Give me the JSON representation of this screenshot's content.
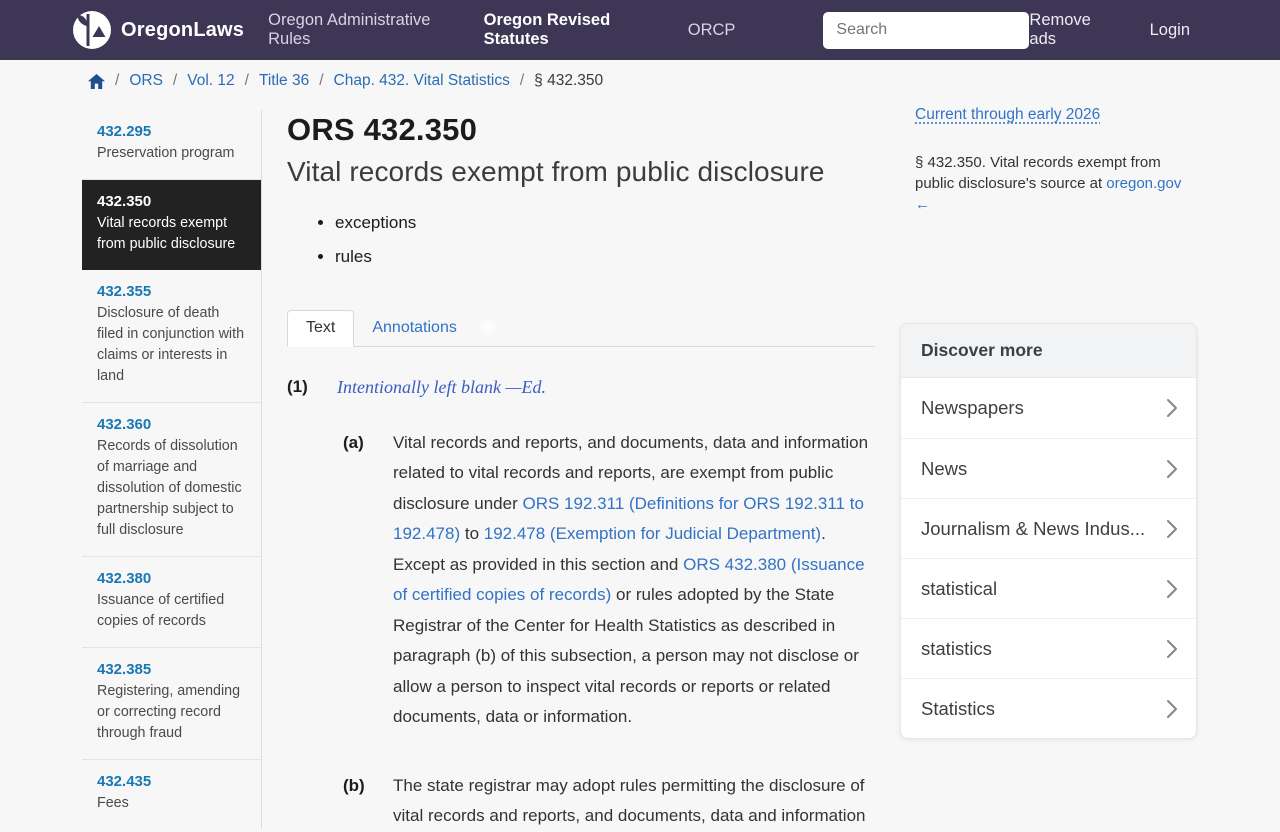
{
  "header": {
    "brand": "OregonLaws",
    "nav": [
      {
        "label": "Oregon Administrative Rules",
        "active": false
      },
      {
        "label": "Oregon Revised Statutes",
        "active": true
      },
      {
        "label": "ORCP",
        "active": false
      }
    ],
    "search_placeholder": "Search",
    "links": [
      {
        "label": "Remove ads"
      },
      {
        "label": "Login"
      }
    ]
  },
  "breadcrumb": {
    "links": [
      "ORS",
      "Vol. 12",
      "Title 36",
      "Chap. 432. Vital Statistics"
    ],
    "current": "§ 432.350"
  },
  "sidebar": {
    "items": [
      {
        "number": "432.295",
        "title": "Preservation program",
        "selected": false
      },
      {
        "number": "432.350",
        "title": "Vital records exempt from public disclosure",
        "selected": true
      },
      {
        "number": "432.355",
        "title": "Disclosure of death filed in conjunction with claims or interests in land",
        "selected": false
      },
      {
        "number": "432.360",
        "title": "Records of dissolution of marriage and dissolution of domestic partnership subject to full disclosure",
        "selected": false
      },
      {
        "number": "432.380",
        "title": "Issuance of certified copies of records",
        "selected": false
      },
      {
        "number": "432.385",
        "title": "Registering, amending or correcting record through fraud",
        "selected": false
      },
      {
        "number": "432.435",
        "title": "Fees",
        "selected": false
      }
    ]
  },
  "main": {
    "statute_number": "ORS 432.350",
    "statute_title": "Vital records exempt from public disclosure",
    "keywords": [
      "exceptions",
      "rules"
    ],
    "tabs": [
      {
        "label": "Text",
        "active": true
      },
      {
        "label": "Annotations",
        "active": false
      }
    ],
    "paragraphs": [
      {
        "label": "(1)",
        "indent": 0,
        "ed_note": true,
        "segments": [
          {
            "text": "Intentionally left blank —Ed.",
            "link": false
          }
        ]
      },
      {
        "label": "(a)",
        "indent": 1,
        "ed_note": false,
        "segments": [
          {
            "text": "Vital records and reports, and documents, data and information related to vital records and reports, are exempt from public disclosure under ",
            "link": false
          },
          {
            "text": "ORS 192.311 (Definitions for ORS 192.311 to 192.478)",
            "link": true
          },
          {
            "text": " to ",
            "link": false
          },
          {
            "text": "192.478 (Exemption for Judicial Department)",
            "link": true
          },
          {
            "text": ". Except as provided in this section and ",
            "link": false
          },
          {
            "text": "ORS 432.380 (Issuance of certified copies of records)",
            "link": true
          },
          {
            "text": " or rules adopted by the State Registrar of the Center for Health Statistics as described in paragraph (b) of this subsection, a person may not disclose or allow a person to inspect vital records or reports or related documents, data or information.",
            "link": false
          }
        ]
      },
      {
        "label": "(b)",
        "indent": 1,
        "ed_note": false,
        "segments": [
          {
            "text": "The state registrar may adopt rules permitting the disclosure of vital records and reports, and documents, data and information",
            "link": false
          }
        ]
      }
    ]
  },
  "aside": {
    "currency_note": "Current through early 2026",
    "source_text_before": "§ 432.350. Vital records exempt from public disclosure's source at ",
    "source_link": "oregon.gov",
    "source_arrow": "←",
    "discover": {
      "title": "Discover more",
      "items": [
        "Newspapers",
        "News",
        "Journalism & News Indus...",
        "statistical",
        "statistics",
        "Statistics"
      ]
    }
  },
  "colors": {
    "header_bg": "#3d3654",
    "selected_item_bg": "#222222",
    "sidebar_number_link": "#1878b4",
    "body_link": "#3273c5",
    "breadcrumb_link": "#2a6cb6",
    "ed_note_link": "#3a5dc4",
    "home_icon": "#1d4e8f"
  }
}
